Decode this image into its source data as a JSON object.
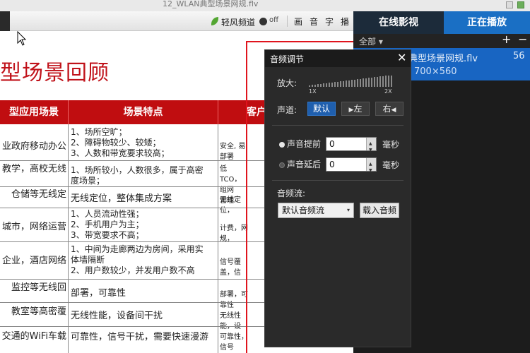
{
  "window": {
    "title": "12_WLAN典型场景网规.flv"
  },
  "toolbar": {
    "qingfeng_label": "轻风频道",
    "toggle_label": "off",
    "buttons": [
      "画",
      "音",
      "字",
      "播"
    ]
  },
  "slide": {
    "heading": "型场景回顾",
    "columns": [
      "型应用场景",
      "场景特点",
      "客户"
    ],
    "rows": [
      {
        "scene": "业政府移动办公",
        "features": [
          "1、场所空旷；",
          "2、障碍物较少、较矮；",
          "3、人数和带宽要求较高；"
        ],
        "customer": "安全, 易部署"
      },
      {
        "scene": "教学，高校无线",
        "features": [
          "1、场所较小，人数很多，属于高密",
          "度场景；"
        ],
        "customer": [
          "低TCO，组网",
          "管理"
        ]
      },
      {
        "scene": "仓储等无线定",
        "features": [
          "无线定位，整体集成方案"
        ],
        "customer": "无线定位，"
      },
      {
        "scene": "城市，网络运营",
        "features": [
          "1、人员流动性强；",
          "2、手机用户为主；",
          "3、带宽要求不高；"
        ],
        "customer": "计费，网规，"
      },
      {
        "scene": "企业，酒店网络",
        "features": [
          "1、中间为走廊两边为房间，采用实",
          "体墙隔断",
          "2、用户数较少，并发用户数不高"
        ],
        "customer": "信号覆盖，信"
      },
      {
        "scene": "监控等无线回",
        "features": [
          "部署，可靠性"
        ],
        "customer": "部署，可靠性"
      },
      {
        "scene": "教室等高密覆",
        "features": [
          "无线性能，设备间干扰"
        ],
        "customer": "无线性能，设"
      },
      {
        "scene": "交通的WiFi车载",
        "features": [
          "可靠性，信号干扰，需要快速漫游"
        ],
        "customer": "可靠性，信号"
      }
    ]
  },
  "playlist": {
    "tabs": [
      "在线影视",
      "正在播放"
    ],
    "filter": "全部",
    "filter_caret": "▾",
    "add_icon": "+",
    "remove_icon": "−",
    "item": {
      "name": "典型场景网规.flv",
      "duration": "56",
      "resolution": "700×560"
    }
  },
  "audio_dialog": {
    "title": "音频调节",
    "close": "✕",
    "zoom_label": "放大:",
    "zoom_min": "1X",
    "zoom_max": "2X",
    "channel_label": "声道:",
    "channel_buttons": [
      "默认",
      "左",
      "右"
    ],
    "channel_left_icon": "▶",
    "channel_right_icon": "◀",
    "advance_label": "声音提前",
    "delay_label": "声音延后",
    "advance_value": "0",
    "delay_value": "0",
    "unit": "毫秒",
    "stream_label": "音频流:",
    "stream_select": "默认音频流",
    "select_caret": "▾",
    "spin_up": "▲",
    "spin_down": "▼",
    "load_button": "载入音频"
  },
  "colors": {
    "accent_blue": "#1865c2",
    "table_header_red": "#c00d10",
    "highlight_red": "#e0141d",
    "heading_red": "#c0121a"
  }
}
